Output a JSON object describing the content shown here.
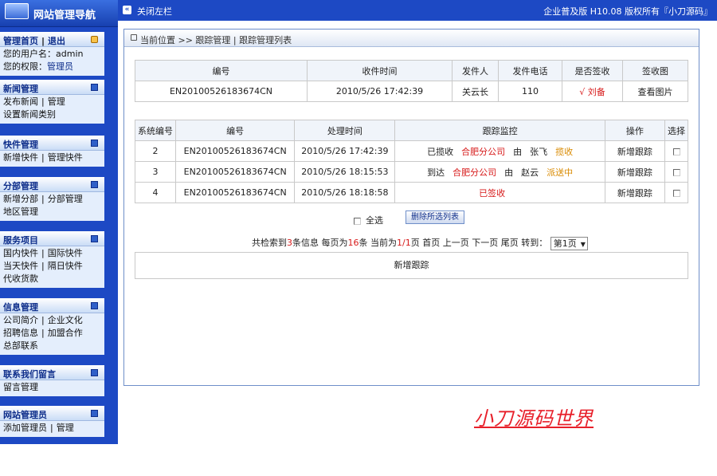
{
  "header": {
    "logo_title": "网站管理导航",
    "toggle_label": "关闭左栏",
    "copyright": "企业普及版  H10.08  版权所有『小刀源码』"
  },
  "sidebar": {
    "top": {
      "home": "管理首页",
      "logout": "退出",
      "user_label": "您的用户名：admin",
      "role_prefix": "您的权限：",
      "role": "管理员"
    },
    "menus": [
      {
        "title": "新闻管理",
        "lines": [
          [
            "发布新闻",
            "管理"
          ],
          [
            "设置新闻类别"
          ]
        ]
      },
      {
        "title": "快件管理",
        "lines": [
          [
            "新增快件",
            "管理快件"
          ]
        ]
      },
      {
        "title": "分部管理",
        "lines": [
          [
            "新增分部",
            "分部管理"
          ],
          [
            "地区管理"
          ]
        ]
      },
      {
        "title": "服务项目",
        "lines": [
          [
            "国内快件",
            "国际快件"
          ],
          [
            "当天快件",
            "隔日快件"
          ],
          [
            "代收货款"
          ]
        ]
      },
      {
        "title": "信息管理",
        "lines": [
          [
            "公司简介",
            "企业文化"
          ],
          [
            "招聘信息",
            "加盟合作"
          ],
          [
            "总部联系"
          ]
        ]
      },
      {
        "title": "联系我们留言",
        "lines": [
          [
            "留言管理"
          ]
        ]
      },
      {
        "title": "网站管理员",
        "lines": [
          [
            "添加管理员",
            "管理"
          ]
        ]
      }
    ]
  },
  "breadcrumb": "当前位置 >> 跟踪管理 | 跟踪管理列表",
  "summary_table": {
    "headers": [
      "编号",
      "收件时间",
      "发件人",
      "发件电话",
      "是否签收",
      "签收图"
    ],
    "row": {
      "number": "EN20100526183674CN",
      "time": "2010/5/26 17:42:39",
      "sender": "关云长",
      "phone": "110",
      "signed": "√ 刘备",
      "image_link": "查看图片"
    }
  },
  "track_table": {
    "headers": [
      "系统编号",
      "编号",
      "处理时间",
      "跟踪监控",
      "操作",
      "选择"
    ],
    "rows": [
      {
        "id": "2",
        "number": "EN20100526183674CN",
        "time": "2010/5/26 17:42:39",
        "m1": "已揽收",
        "m2": "合肥分公司",
        "m3": "由",
        "m4": "张飞",
        "m5": "揽收",
        "action": "新增跟踪"
      },
      {
        "id": "3",
        "number": "EN20100526183674CN",
        "time": "2010/5/26 18:15:53",
        "m1": "到达",
        "m2": "合肥分公司",
        "m3": "由",
        "m4": "赵云",
        "m5": "派送中",
        "action": "新增跟踪"
      },
      {
        "id": "4",
        "number": "EN20100526183674CN",
        "time": "2010/5/26 18:18:58",
        "m1": "",
        "m2": "已签收",
        "m3": "",
        "m4": "",
        "m5": "",
        "action": "新增跟踪"
      }
    ]
  },
  "select_all_label": "全选",
  "delete_button": "删除所选列表",
  "pager": {
    "t1": "共检索到",
    "total": "3",
    "t2": "条信息   每页为",
    "per_page": "16",
    "t3": "条   当前为",
    "current": "1/1",
    "t4": "页",
    "first": "首页",
    "prev": "上一页",
    "next": "下一页",
    "last": "尾页",
    "goto": "转到：",
    "page_option": "第1页"
  },
  "add_tracking": "新增跟踪",
  "watermark": "小刀源码世界",
  "colors": {
    "nav_blue": "#1d49c4",
    "accent_red": "#d71a1a",
    "accent_orange": "#d98a00"
  }
}
